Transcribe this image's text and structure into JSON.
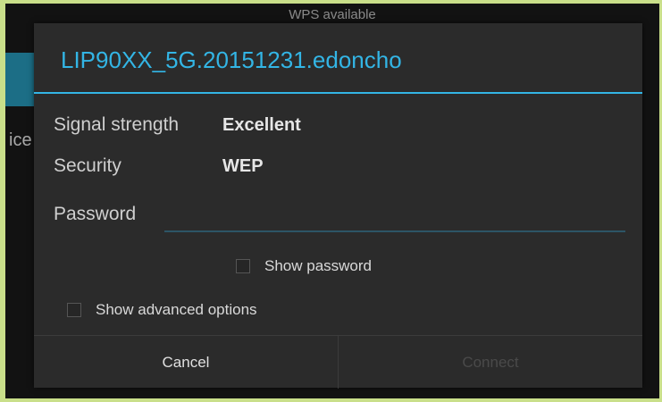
{
  "background": {
    "status_text": "WPS available",
    "side_text": "ice"
  },
  "dialog": {
    "title": "LIP90XX_5G.20151231.edoncho",
    "signal_label": "Signal strength",
    "signal_value": "Excellent",
    "security_label": "Security",
    "security_value": "WEP",
    "password_label": "Password",
    "password_value": "",
    "show_password_label": "Show password",
    "show_password_checked": false,
    "advanced_label": "Show advanced options",
    "advanced_checked": false,
    "cancel_label": "Cancel",
    "connect_label": "Connect",
    "connect_enabled": false
  },
  "colors": {
    "accent": "#33b5e5",
    "dialog_bg": "#2b2b2b",
    "disabled_text": "#4a4a4a"
  }
}
